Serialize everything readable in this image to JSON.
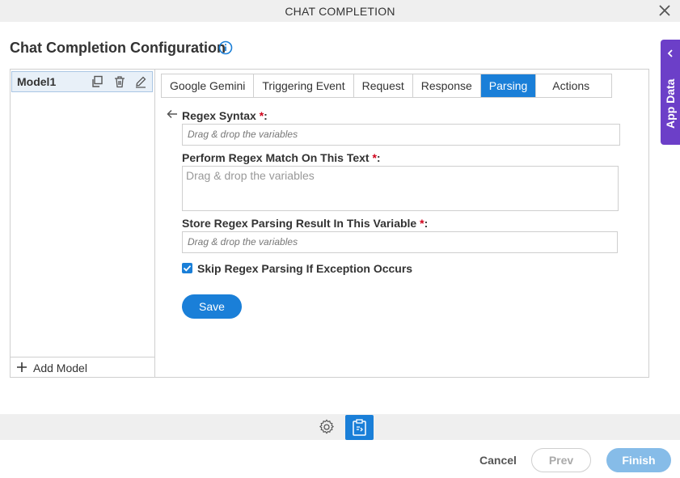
{
  "window": {
    "title": "CHAT COMPLETION"
  },
  "page": {
    "heading": "Chat Completion Configuration"
  },
  "app_data": {
    "label": "App Data"
  },
  "models": {
    "items": [
      {
        "name": "Model1"
      }
    ],
    "add_label": "Add Model"
  },
  "tabs": [
    {
      "label": "Google Gemini",
      "active": false
    },
    {
      "label": "Triggering Event",
      "active": false
    },
    {
      "label": "Request",
      "active": false
    },
    {
      "label": "Response",
      "active": false
    },
    {
      "label": "Parsing",
      "active": true
    },
    {
      "label": "Actions",
      "active": false
    }
  ],
  "form": {
    "regex_syntax": {
      "label": "Regex Syntax",
      "required_mark": "*",
      "placeholder": "Drag & drop the variables"
    },
    "match_text": {
      "label": "Perform Regex Match On This Text",
      "required_mark": "*",
      "placeholder": "Drag & drop the variables"
    },
    "store_result": {
      "label": "Store Regex Parsing Result In This Variable",
      "required_mark": "*",
      "placeholder": "Drag & drop the variables"
    },
    "skip_exception": {
      "label": "Skip Regex Parsing If Exception Occurs",
      "checked": true
    },
    "save_label": "Save"
  },
  "footer": {
    "cancel": "Cancel",
    "prev": "Prev",
    "finish": "Finish"
  },
  "colors": {
    "accent": "#1a7fd8",
    "app_data_tab": "#6c3fc8",
    "required": "#d0021b"
  }
}
